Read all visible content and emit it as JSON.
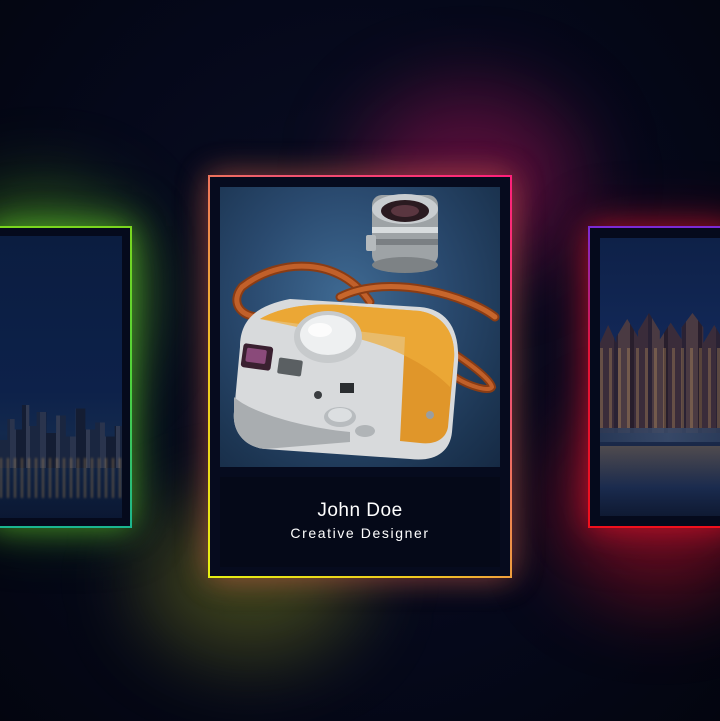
{
  "profile_card": {
    "name": "John Doe",
    "role": "Creative Designer"
  },
  "images": {
    "left_card": "city-skyline-night",
    "center_card": "vintage-camera-with-lens",
    "right_card": "canal-houses-night"
  },
  "colors": {
    "background": "#05081a",
    "left_glow": "#6ed62a",
    "center_glow_top": "#ff1f7a",
    "center_glow_bottom": "#e6f012",
    "right_glow": "#f0101c"
  }
}
